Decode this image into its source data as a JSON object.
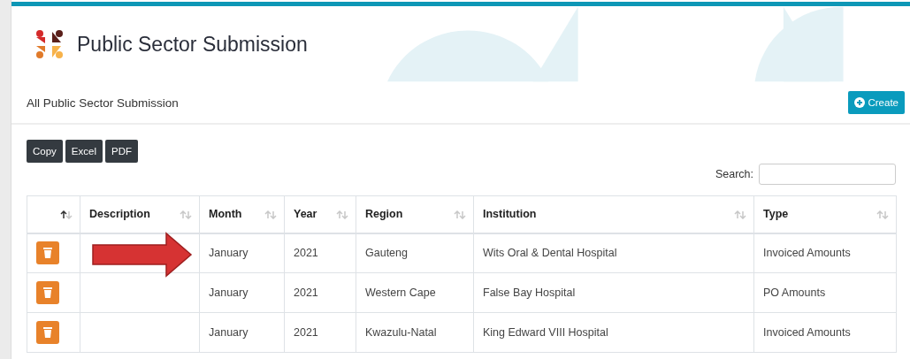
{
  "page": {
    "title": "Public Sector Submission"
  },
  "card": {
    "title": "All Public Sector Submission",
    "create_button": "Create"
  },
  "export_buttons": [
    "Copy",
    "Excel",
    "PDF"
  ],
  "search": {
    "label": "Search:"
  },
  "table": {
    "columns": [
      {
        "sorted_ascending": true
      },
      {
        "label": "Description",
        "sorted_ascending": false
      },
      {
        "label": "Month",
        "sorted_ascending": false
      },
      {
        "label": "Year",
        "sorted_ascending": false
      },
      {
        "label": "Region",
        "sorted_ascending": false
      },
      {
        "label": "Institution",
        "sorted_ascending": false
      },
      {
        "label": "Type",
        "sorted_ascending": false
      }
    ],
    "rows": [
      {
        "month": "January",
        "year": "2021",
        "region": "Gauteng",
        "institution": "Wits Oral & Dental Hospital",
        "type": "Invoiced Amounts"
      },
      {
        "month": "January",
        "year": "2021",
        "region": "Western Cape",
        "institution": "False Bay Hospital",
        "type": "PO Amounts"
      },
      {
        "month": "January",
        "year": "2021",
        "region": "Kwazulu-Natal",
        "institution": "King Edward VIII Hospital",
        "type": "Invoiced Amounts"
      }
    ]
  }
}
